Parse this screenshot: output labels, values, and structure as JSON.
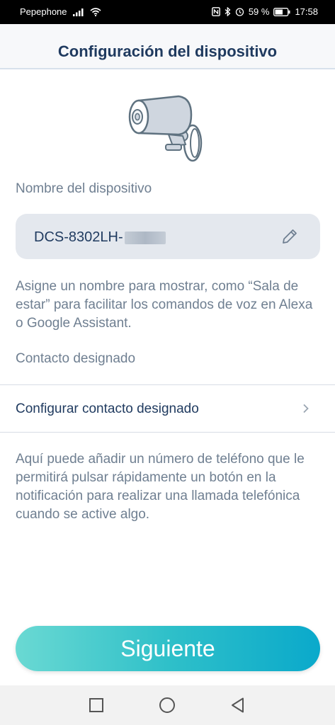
{
  "status_bar": {
    "carrier": "Pepephone",
    "battery_percent": "59 %",
    "time": "17:58",
    "icons": [
      "signal-icon",
      "wifi-icon",
      "nfc-icon",
      "bluetooth-icon",
      "alarm-icon",
      "battery-icon"
    ]
  },
  "header": {
    "title": "Configuración del dispositivo"
  },
  "illustration": {
    "icon": "camera-icon"
  },
  "device_name": {
    "label": "Nombre del dispositivo",
    "value": "DCS-8302LH-",
    "edit_icon": "pencil-icon",
    "help": "Asigne un nombre para mostrar, como “Sala de estar” para facilitar los comandos de voz en Alexa o Google Assistant."
  },
  "designated_contact": {
    "label": "Contacto designado",
    "row_label": "Configurar contacto designado",
    "row_icon": "chevron-right-icon",
    "help": "Aquí puede añadir un número de teléfono que le permitirá pulsar rápidamente un botón en la notificación para realizar una llamada telefónica cuando se active algo."
  },
  "next_button": {
    "label": "Siguiente"
  },
  "nav_bar": {
    "icons": [
      "recent-apps-icon",
      "home-icon",
      "back-icon"
    ]
  },
  "colors": {
    "title": "#1f3a5f",
    "secondary_text": "#6f7f91",
    "field_background": "#e4e8ee",
    "button_gradient_start": "#6ad9d3",
    "button_gradient_end": "#0aa9cb"
  }
}
